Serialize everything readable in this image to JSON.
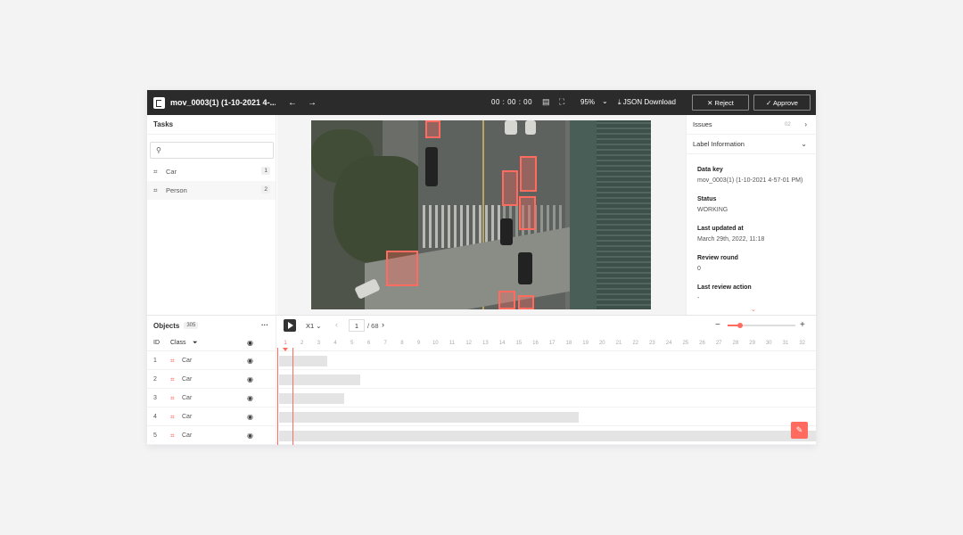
{
  "header": {
    "title": "mov_0003(1) (1-10-2021 4-...",
    "back_icon": "arrow-left-icon",
    "forward_icon": "arrow-right-icon",
    "timecode": "00 : 00 : 00",
    "zoom": "95%",
    "json_download": "⤓ JSON Download",
    "reject": "✕ Reject",
    "approve": "✓ Approve"
  },
  "tasks": {
    "title": "Tasks",
    "search_placeholder": "",
    "items": [
      {
        "label": "Car",
        "count": "1"
      },
      {
        "label": "Person",
        "count": "2"
      }
    ]
  },
  "right_panel": {
    "issues_label": "Issues",
    "issues_count": "02",
    "label_info_title": "Label Information",
    "fields": [
      {
        "label": "Data key",
        "value": "mov_0003(1) (1-10-2021 4-57-01 PM)"
      },
      {
        "label": "Status",
        "value": "WORKING"
      },
      {
        "label": "Last updated at",
        "value": "March 29th, 2022, 11:18"
      },
      {
        "label": "Review round",
        "value": "0"
      },
      {
        "label": "Last review action",
        "value": "-"
      }
    ]
  },
  "objects": {
    "title": "Objects",
    "count": "305",
    "more": "···",
    "columns": {
      "id": "ID",
      "class": "Class"
    },
    "rows": [
      {
        "id": "1",
        "class": "Car"
      },
      {
        "id": "2",
        "class": "Car"
      },
      {
        "id": "3",
        "class": "Car"
      },
      {
        "id": "4",
        "class": "Car"
      },
      {
        "id": "5",
        "class": "Car"
      }
    ]
  },
  "player": {
    "speed": "X1 ⌄",
    "current_frame": "1",
    "total_frames": "/ 68",
    "ticks": [
      "1",
      "2",
      "3",
      "4",
      "5",
      "6",
      "7",
      "8",
      "9",
      "10",
      "11",
      "12",
      "13",
      "14",
      "15",
      "16",
      "17",
      "18",
      "19",
      "20",
      "21",
      "22",
      "23",
      "24",
      "25",
      "26",
      "27",
      "28",
      "29",
      "30",
      "31",
      "32"
    ]
  },
  "colors": {
    "accent": "#ff6b5e",
    "topbar": "#2b2b2b"
  }
}
